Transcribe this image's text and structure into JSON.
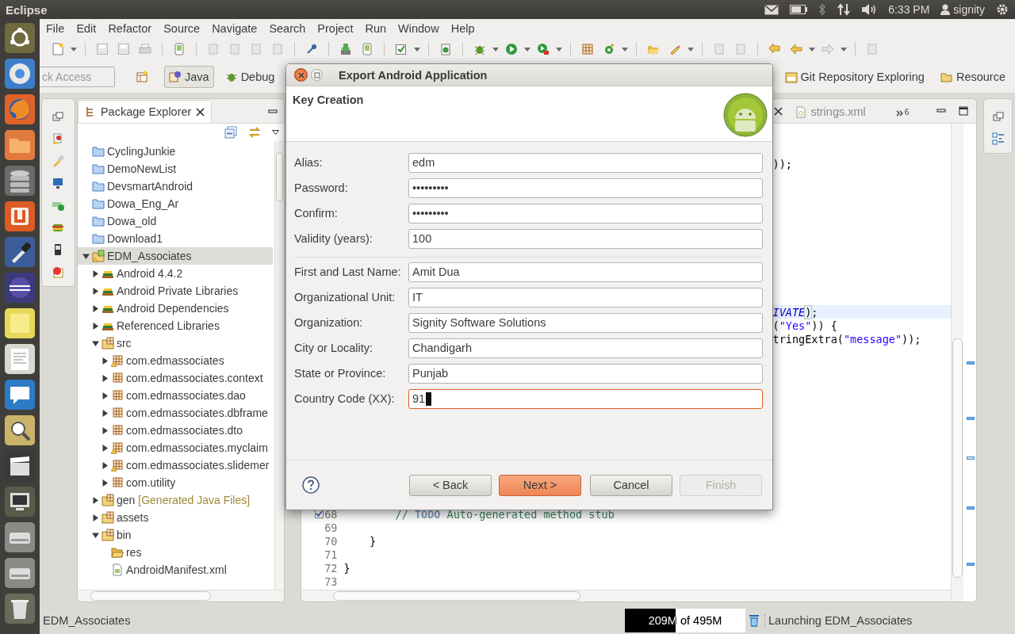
{
  "top_panel": {
    "app_name": "Eclipse",
    "clock": "6:33 PM",
    "user": "signity"
  },
  "menu": [
    "File",
    "Edit",
    "Refactor",
    "Source",
    "Navigate",
    "Search",
    "Project",
    "Run",
    "Window",
    "Help"
  ],
  "quick_access": {
    "placeholder": "ck Access"
  },
  "perspectives": [
    {
      "label": "Java",
      "selected": true
    },
    {
      "label": "Debug",
      "selected": false
    },
    {
      "label": "Git Repository Exploring",
      "selected": false
    },
    {
      "label": "Resource",
      "selected": false
    }
  ],
  "package_explorer": {
    "title": "Package Explorer",
    "tree": [
      {
        "label": "CyclingJunkie",
        "kind": "project",
        "selected": false
      },
      {
        "label": "DemoNewList",
        "kind": "project",
        "selected": false
      },
      {
        "label": "DevsmartAndroid",
        "kind": "project",
        "selected": false
      },
      {
        "label": "Dowa_Eng_Ar",
        "kind": "project",
        "selected": false
      },
      {
        "label": "Dowa_old",
        "kind": "project",
        "selected": false
      },
      {
        "label": "Download1",
        "kind": "project",
        "selected": false
      },
      {
        "label": "EDM_Associates",
        "kind": "android_project",
        "expanded": true,
        "selected": true,
        "children": [
          {
            "label": "Android 4.4.2",
            "kind": "library",
            "expanded": false,
            "selected": false
          },
          {
            "label": "Android Private Libraries",
            "kind": "library",
            "expanded": false,
            "selected": false
          },
          {
            "label": "Android Dependencies",
            "kind": "library",
            "expanded": false,
            "selected": false
          },
          {
            "label": "Referenced Libraries",
            "kind": "library",
            "expanded": false,
            "selected": false
          },
          {
            "label": "src",
            "kind": "source_folder",
            "expanded": true,
            "selected": false,
            "children": [
              {
                "label": "com.edmassociates",
                "kind": "package_warning",
                "expanded": false,
                "selected": false
              },
              {
                "label": "com.edmassociates.context",
                "kind": "package",
                "expanded": false,
                "selected": false
              },
              {
                "label": "com.edmassociates.dao",
                "kind": "package",
                "expanded": false,
                "selected": false
              },
              {
                "label": "com.edmassociates.dbframe",
                "kind": "package",
                "expanded": false,
                "selected": false
              },
              {
                "label": "com.edmassociates.dto",
                "kind": "package",
                "expanded": false,
                "selected": false
              },
              {
                "label": "com.edmassociates.myclaim",
                "kind": "package_warning",
                "expanded": false,
                "selected": false
              },
              {
                "label": "com.edmassociates.slidemer",
                "kind": "package_warning",
                "expanded": false,
                "selected": false
              },
              {
                "label": "com.utility",
                "kind": "package",
                "expanded": false,
                "selected": false
              }
            ]
          },
          {
            "label": "gen",
            "decoration": "[Generated Java Files]",
            "kind": "gen_folder",
            "expanded": false,
            "selected": false
          },
          {
            "label": "assets",
            "kind": "gen_folder",
            "expanded": false,
            "selected": false
          },
          {
            "label": "bin",
            "kind": "gen_folder",
            "expanded": true,
            "selected": false,
            "children": [
              {
                "label": "res",
                "kind": "open_folder",
                "selected": false
              },
              {
                "label": "AndroidManifest.xml",
                "kind": "xml_file",
                "selected": false
              }
            ]
          }
        ]
      }
    ]
  },
  "editor": {
    "tabs": [
      {
        "label": "strings.xml",
        "selected": false
      }
    ],
    "overflow_count": "6",
    "fragments": [
      {
        "current": false,
        "tokens": [
          {
            "kind": "plain",
            "text": "));"
          }
        ]
      },
      {
        "current": true,
        "tokens": [
          {
            "kind": "constant",
            "text": "IVATE"
          },
          {
            "kind": "bracket",
            "text": ")"
          },
          {
            "kind": "plain",
            "text": ";"
          }
        ]
      },
      {
        "current": false,
        "tokens": [
          {
            "kind": "plain",
            "text": "("
          },
          {
            "kind": "string",
            "text": "\"Yes\""
          },
          {
            "kind": "plain",
            "text": ")) {"
          }
        ]
      },
      {
        "current": false,
        "tokens": [
          {
            "kind": "plain",
            "text": "tringExtra("
          },
          {
            "kind": "string",
            "text": "\"message\""
          },
          {
            "kind": "plain",
            "text": "));"
          }
        ]
      }
    ],
    "lines": [
      {
        "number": "68",
        "tokens": [
          {
            "kind": "comment",
            "text": "        // "
          },
          {
            "kind": "task_tag",
            "text": "TODO"
          },
          {
            "kind": "comment",
            "text": " Auto-generated method stub"
          }
        ]
      },
      {
        "number": "69"
      },
      {
        "number": "70",
        "tokens": [
          {
            "kind": "plain",
            "text": "    }"
          }
        ]
      },
      {
        "number": "71"
      },
      {
        "number": "72",
        "tokens": [
          {
            "kind": "plain",
            "text": "}"
          }
        ]
      },
      {
        "number": "73"
      }
    ]
  },
  "dialog": {
    "title": "Export Android Application",
    "heading": "Key Creation",
    "key_fields": [
      {
        "label": "Alias:",
        "value": "edm",
        "focused": false
      },
      {
        "label": "Password:",
        "value": "•••••••••",
        "focused": false
      },
      {
        "label": "Confirm:",
        "value": "•••••••••",
        "focused": false
      },
      {
        "label": "Validity (years):",
        "value": "100",
        "focused": false
      }
    ],
    "owner_fields": [
      {
        "label": "First and Last Name:",
        "value": "Amit Dua",
        "focused": false
      },
      {
        "label": "Organizational Unit:",
        "value": "IT",
        "focused": false
      },
      {
        "label": "Organization:",
        "value": "Signity Software Solutions",
        "focused": false
      },
      {
        "label": "City or Locality:",
        "value": "Chandigarh",
        "focused": false
      },
      {
        "label": "State or Province:",
        "value": "Punjab",
        "focused": false
      },
      {
        "label": "Country Code (XX):",
        "value": "91",
        "focused": true
      }
    ],
    "buttons": [
      {
        "label": "< Back",
        "default": false,
        "disabled": false
      },
      {
        "label": "Next >",
        "default": true,
        "disabled": false
      },
      {
        "label": "Cancel",
        "default": false,
        "disabled": false
      },
      {
        "label": "Finish",
        "default": false,
        "disabled": true
      }
    ]
  },
  "status_bar": {
    "selection": "EDM_Associates",
    "heap": {
      "label": "209M of 495M",
      "level": 0.42
    },
    "job": "Launching EDM_Associates"
  }
}
